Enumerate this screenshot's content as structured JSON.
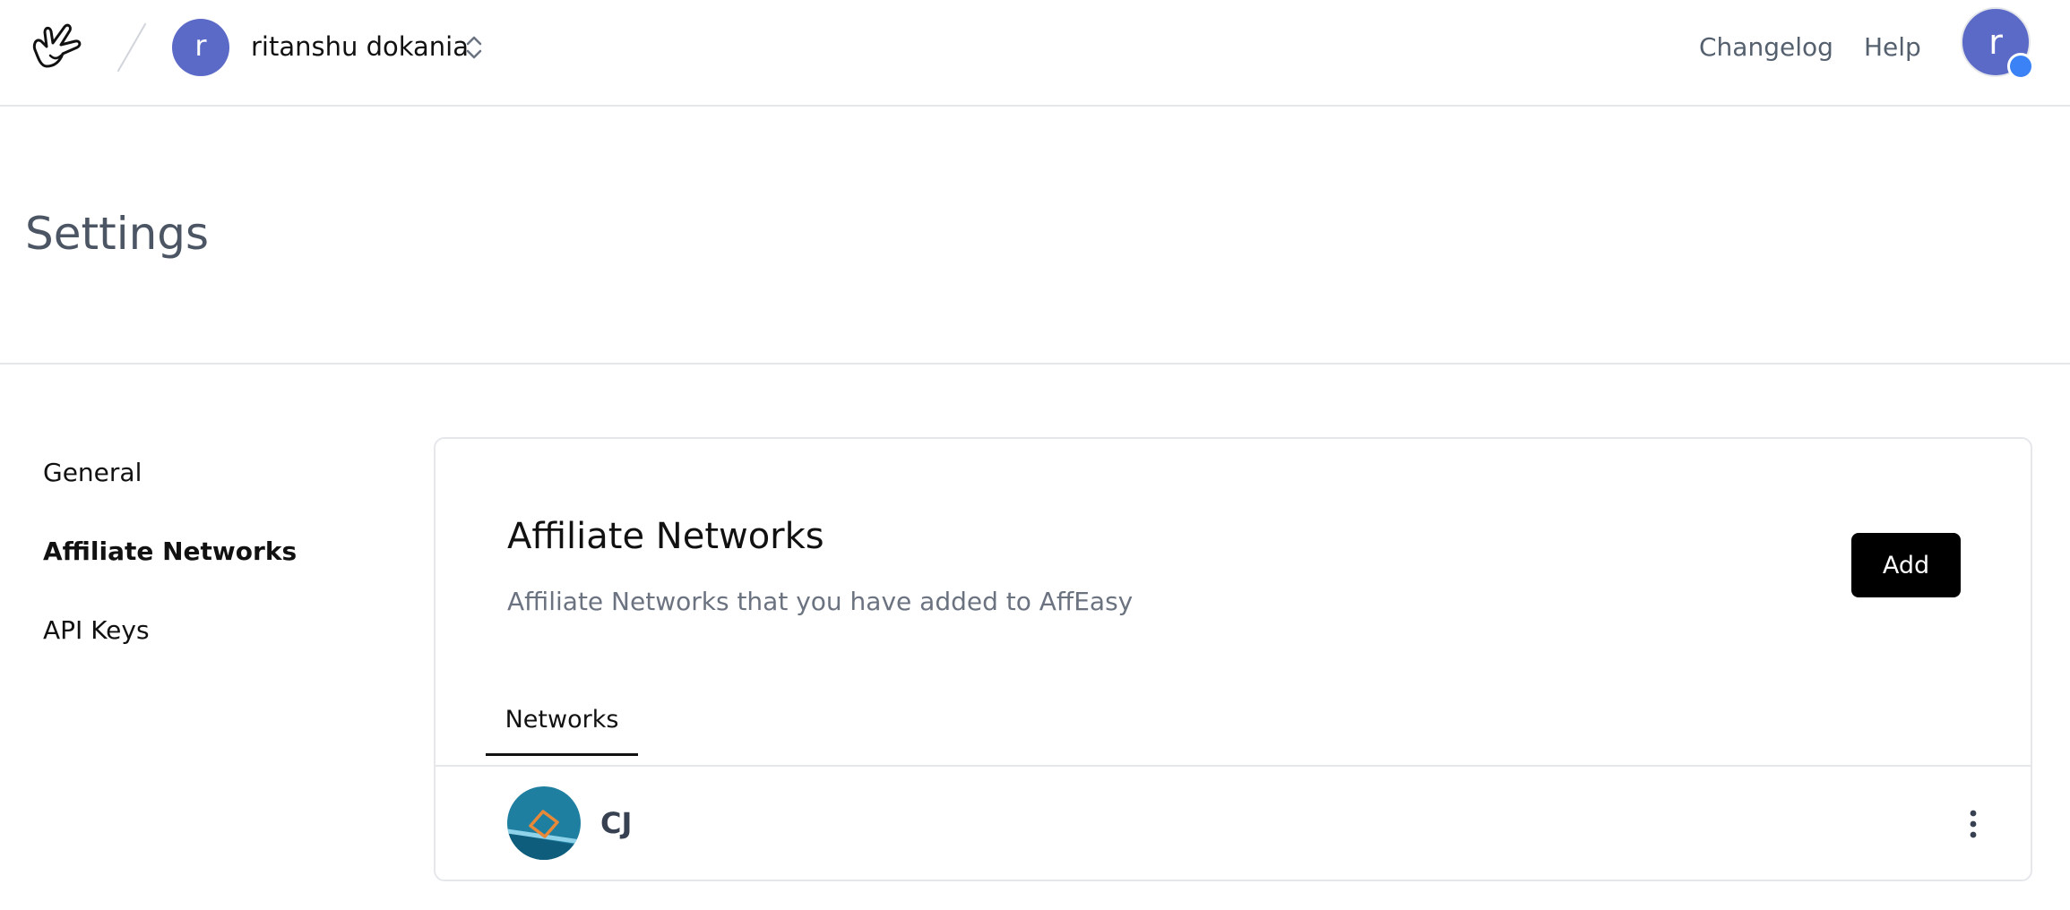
{
  "header": {
    "logo_icon": "hand-gesture-logo",
    "team": {
      "avatar_letter": "r",
      "name": "ritanshu dokania",
      "switch_icon": "chevron-up-down-icon"
    },
    "nav": {
      "changelog": "Changelog",
      "help": "Help"
    },
    "user": {
      "avatar_letter": "r",
      "status_color": "#3b82f6"
    }
  },
  "page": {
    "title": "Settings"
  },
  "sidebar": {
    "items": [
      {
        "label": "General",
        "active": false
      },
      {
        "label": "Affiliate Networks",
        "active": true
      },
      {
        "label": "API Keys",
        "active": false
      }
    ]
  },
  "card": {
    "title": "Affiliate Networks",
    "description": "Affiliate Networks that you have added to AffEasy",
    "add_label": "Add",
    "tabs": [
      {
        "label": "Networks",
        "active": true
      }
    ],
    "networks": [
      {
        "name": "CJ",
        "logo_icon": "cj-logo",
        "menu_icon": "kebab-menu-icon"
      }
    ]
  },
  "colors": {
    "avatar": "#5b6ac7",
    "primary_button": "#000000",
    "muted_text": "#6b7280"
  }
}
